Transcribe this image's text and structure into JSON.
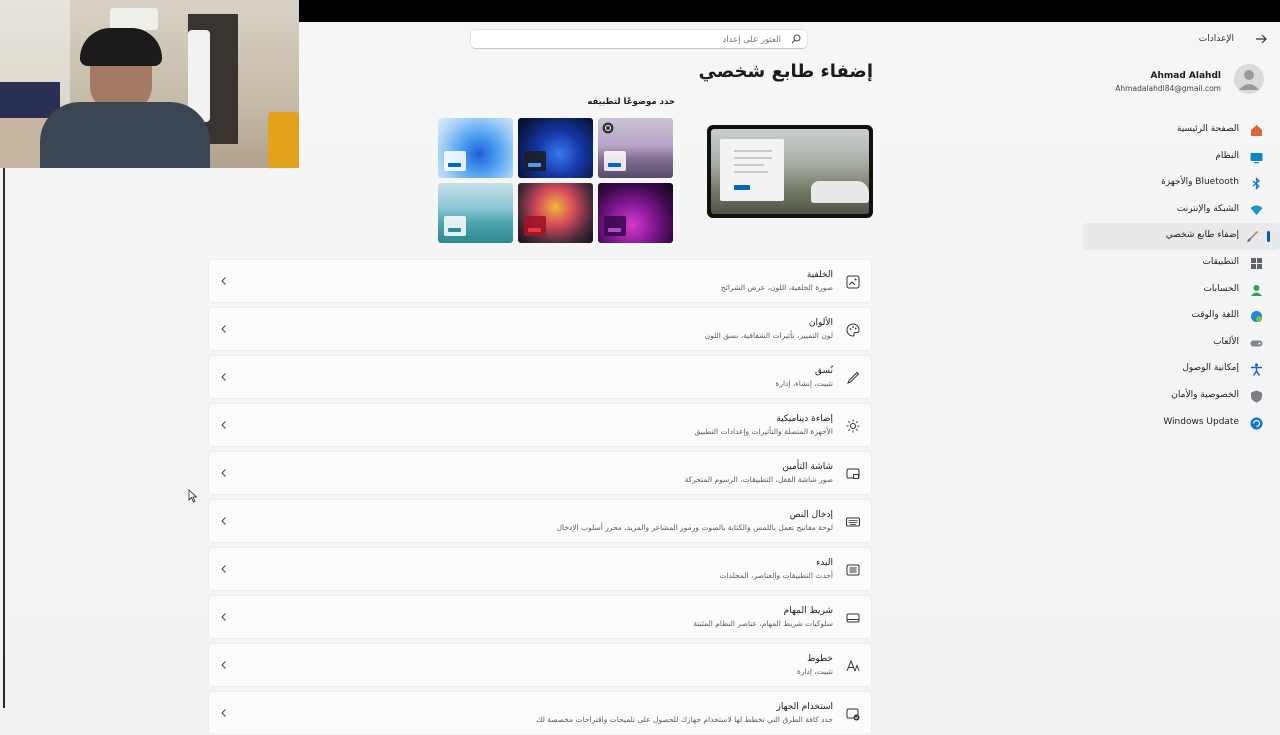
{
  "window": {
    "app_title": "الإعدادات",
    "search_placeholder": "العثور على إعداد"
  },
  "profile": {
    "name": "Ahmad Alahdl",
    "email": "Ahmadalahdl84@gmail.com"
  },
  "nav": [
    {
      "label": "الصفحة الرئيسية",
      "icon": "home-icon",
      "color": "#e0643f"
    },
    {
      "label": "النظام",
      "icon": "display-icon",
      "color": "#0b87c9"
    },
    {
      "label": "Bluetooth والأجهزة",
      "icon": "bluetooth-icon",
      "color": "#1a73d9"
    },
    {
      "label": "الشبكة والإنترنت",
      "icon": "wifi-icon",
      "color": "#1e90d6"
    },
    {
      "label": "إضفاء طابع شخصي",
      "icon": "brush-icon",
      "color": "#c27a2c",
      "active": true
    },
    {
      "label": "التطبيقات",
      "icon": "apps-icon",
      "color": "#5a6470"
    },
    {
      "label": "الحسابات",
      "icon": "accounts-icon",
      "color": "#2ea34a"
    },
    {
      "label": "اللغة والوقت",
      "icon": "globe-clock-icon",
      "color": "#1c8ad6"
    },
    {
      "label": "الألعاب",
      "icon": "gamepad-icon",
      "color": "#7c8792"
    },
    {
      "label": "إمكانية الوصول",
      "icon": "accessibility-icon",
      "color": "#1565c0"
    },
    {
      "label": "الخصوصية والأمان",
      "icon": "shield-icon",
      "color": "#7a7f86"
    },
    {
      "label": "Windows Update",
      "icon": "update-icon",
      "color": "#0a78d4"
    }
  ],
  "page": {
    "title": "إضفاء طابع شخصي",
    "themes_label": "حدد موضوعًا لتطبيقه"
  },
  "settings": [
    {
      "title": "الخلفية",
      "subtitle": "صورة الخلفية، اللون، عرض الشرائح",
      "icon": "picture-icon"
    },
    {
      "title": "الألوان",
      "subtitle": "لون التمييز، تأثيرات الشفافية، نسق اللون",
      "icon": "palette-icon"
    },
    {
      "title": "نُسق",
      "subtitle": "تثبيت، إنشاء، إدارة",
      "icon": "pen-icon"
    },
    {
      "title": "إضاءة ديناميكية",
      "subtitle": "الأجهزة المتصلة والتأثيرات وإعدادات التطبيق",
      "icon": "sun-icon"
    },
    {
      "title": "شاشة التأمين",
      "subtitle": "صور شاشة القفل، التطبيقات، الرسوم المتحركة",
      "icon": "lock-screen-icon"
    },
    {
      "title": "إدخال النص",
      "subtitle": "لوحة مفاتيح تعمل باللمس والكتابة بالصوت ورموز المشاعر والمزيد، محرر أسلوب الإدخال",
      "icon": "keyboard-icon"
    },
    {
      "title": "البدء",
      "subtitle": "أحدث التطبيقات والعناصر، المجلدات",
      "icon": "start-icon"
    },
    {
      "title": "شريط المهام",
      "subtitle": "سلوكيات شريط المهام، عناصر النظام المثبتة",
      "icon": "taskbar-icon"
    },
    {
      "title": "خطوط",
      "subtitle": "تثبيت، إدارة",
      "icon": "font-icon"
    },
    {
      "title": "استخدام الجهاز",
      "subtitle": "حدد كافة الطرق التي تخطط لها لاستخدام جهازك للحصول على تلميحات واقتراحات مخصصة لك",
      "icon": "device-usage-icon"
    }
  ]
}
